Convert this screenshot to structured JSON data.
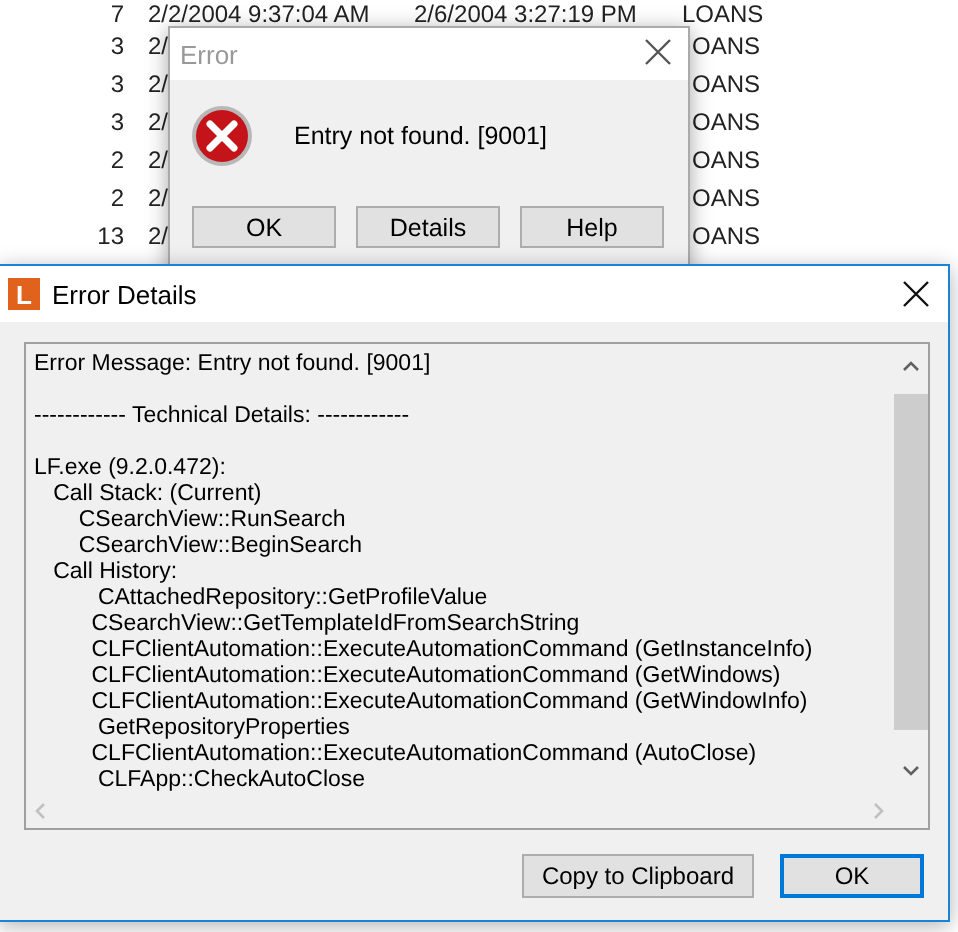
{
  "background_list": {
    "rows": [
      {
        "count": "7",
        "column_2": "2/2/2004 9:37:04 AM",
        "column_3": "2/6/2004 3:27:19 PM",
        "column_4": "LOANS"
      },
      {
        "count": "3",
        "column_2": "2/",
        "column_4": "OANS"
      },
      {
        "count": "3",
        "column_2": "2/",
        "column_4": "OANS"
      },
      {
        "count": "3",
        "column_2": "2/",
        "column_4": "OANS"
      },
      {
        "count": "2",
        "column_2": "2/",
        "column_4": "OANS"
      },
      {
        "count": "2",
        "column_2": "2/",
        "column_4": "OANS"
      },
      {
        "count": "13",
        "column_2": "2/",
        "column_4": "OANS"
      }
    ]
  },
  "error_dialog": {
    "title": "Error",
    "active": false,
    "message": "Entry not found. [9001]",
    "buttons": [
      "OK",
      "Details",
      "Help"
    ]
  },
  "details_window": {
    "title": "Error Details",
    "app_icon": "L",
    "active": true,
    "blocks": [
      [
        "Error Message: Entry not found. [9001]"
      ],
      [
        "------------ Technical Details: ------------"
      ],
      [
        "LF.exe (9.2.0.472):",
        "   Call Stack: (Current)",
        "       CSearchView::RunSearch",
        "       CSearchView::BeginSearch",
        "   Call History:",
        "          CAttachedRepository::GetProfileValue",
        "         CSearchView::GetTemplateIdFromSearchString",
        "         CLFClientAutomation::ExecuteAutomationCommand (GetInstanceInfo)",
        "         CLFClientAutomation::ExecuteAutomationCommand (GetWindows)",
        "         CLFClientAutomation::ExecuteAutomationCommand (GetWindowInfo)",
        "          GetRepositoryProperties",
        "         CLFClientAutomation::ExecuteAutomationCommand (AutoClose)",
        "          CLFApp::CheckAutoClose"
      ]
    ],
    "buttons": [
      {
        "label": "Copy to Clipboard",
        "default": false
      },
      {
        "label": "OK",
        "default": true
      }
    ]
  }
}
